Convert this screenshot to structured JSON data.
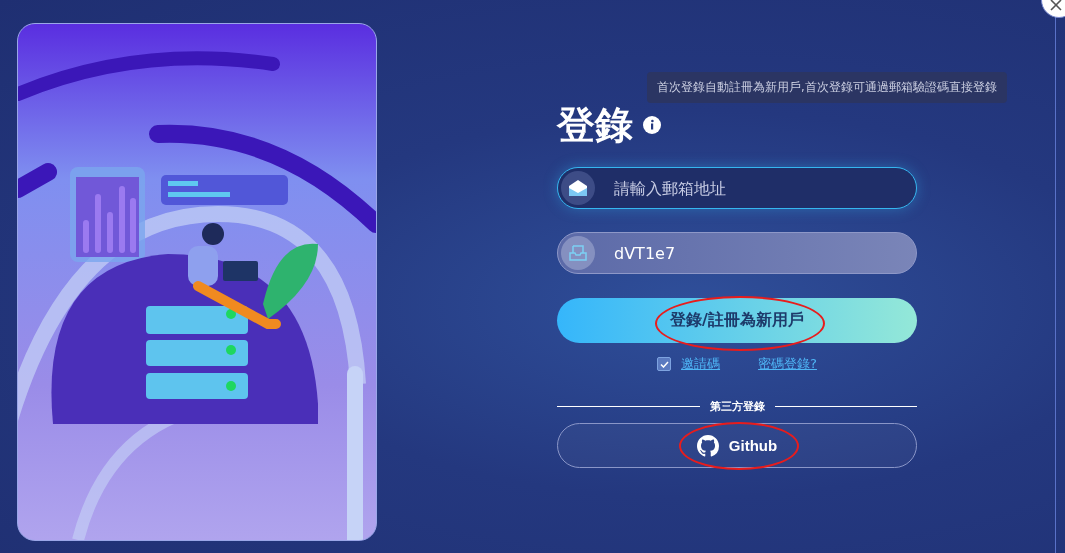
{
  "tooltip": "首次登錄自動註冊為新用戶,首次登錄可通過郵箱驗證碼直接登錄",
  "title": "登錄",
  "email_field": {
    "placeholder": "請輸入郵箱地址"
  },
  "code_field": {
    "value": "dVT1e7"
  },
  "login_button": "登錄/註冊為新用戶",
  "invite_code": {
    "label": "邀請碼",
    "checked": true
  },
  "password_link": "密碼登錄?",
  "divider_label": "第三方登錄",
  "github_button": "Github"
}
